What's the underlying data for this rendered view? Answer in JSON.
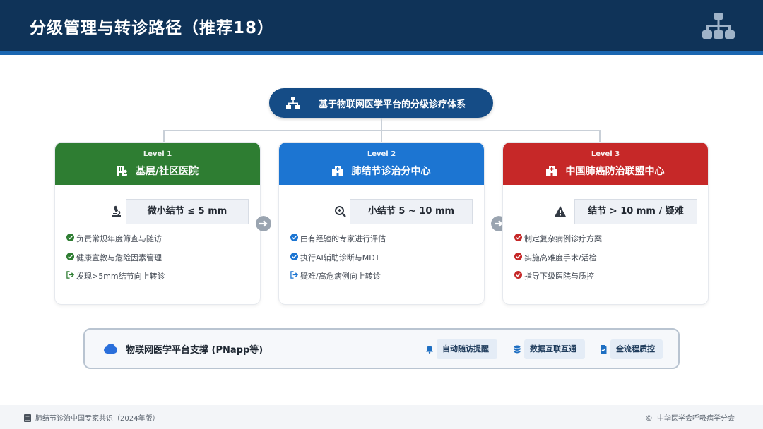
{
  "header": {
    "title": "分级管理与转诊路径（推荐18）",
    "icon": "sitemap-icon"
  },
  "root": {
    "label": "基于物联网医学平台的分级诊疗体系",
    "icon": "hierarchy-icon"
  },
  "levels": [
    {
      "level": "Level 1",
      "title": "基层/社区医院",
      "color": "#2e7d32",
      "icon": "clinic-icon",
      "criteria": "微小结节 ≤ 5 mm",
      "criteria_icon": "microscope-icon",
      "items": [
        {
          "text": "负责常规年度筛查与随访",
          "icon": "check-circle-icon"
        },
        {
          "text": "健康宣教与危险因素管理",
          "icon": "check-circle-icon"
        },
        {
          "text": "发现>5mm结节向上转诊",
          "icon": "referral-arrow-icon"
        }
      ]
    },
    {
      "level": "Level 2",
      "title": "肺结节诊治分中心",
      "color": "#1c75d2",
      "icon": "hospital-icon",
      "criteria": "小结节 5 ~ 10 mm",
      "criteria_icon": "magnifier-icon",
      "items": [
        {
          "text": "由有经验的专家进行评估",
          "icon": "check-circle-icon"
        },
        {
          "text": "执行AI辅助诊断与MDT",
          "icon": "check-circle-icon"
        },
        {
          "text": "疑难/高危病例向上转诊",
          "icon": "referral-arrow-icon"
        }
      ]
    },
    {
      "level": "Level 3",
      "title": "中国肺癌防治联盟中心",
      "color": "#c62828",
      "icon": "hospital-icon",
      "criteria": "结节 > 10 mm / 疑难",
      "criteria_icon": "warning-icon",
      "items": [
        {
          "text": "制定复杂病例诊疗方案",
          "icon": "check-circle-icon"
        },
        {
          "text": "实施高难度手术/活检",
          "icon": "check-circle-icon"
        },
        {
          "text": "指导下级医院与质控",
          "icon": "check-circle-icon"
        }
      ]
    }
  ],
  "platform": {
    "label": "物联网医学平台支撑 (PNapp等)",
    "icon": "cloud-icon",
    "features": [
      {
        "label": "自动随访提醒",
        "icon": "bell-icon"
      },
      {
        "label": "数据互联互通",
        "icon": "database-icon"
      },
      {
        "label": "全流程质控",
        "icon": "file-check-icon"
      }
    ]
  },
  "footer": {
    "left": "肺结节诊治中国专家共识（2024年版）",
    "right": "中华医学会呼吸病学分会",
    "copyright_symbol": "©"
  }
}
